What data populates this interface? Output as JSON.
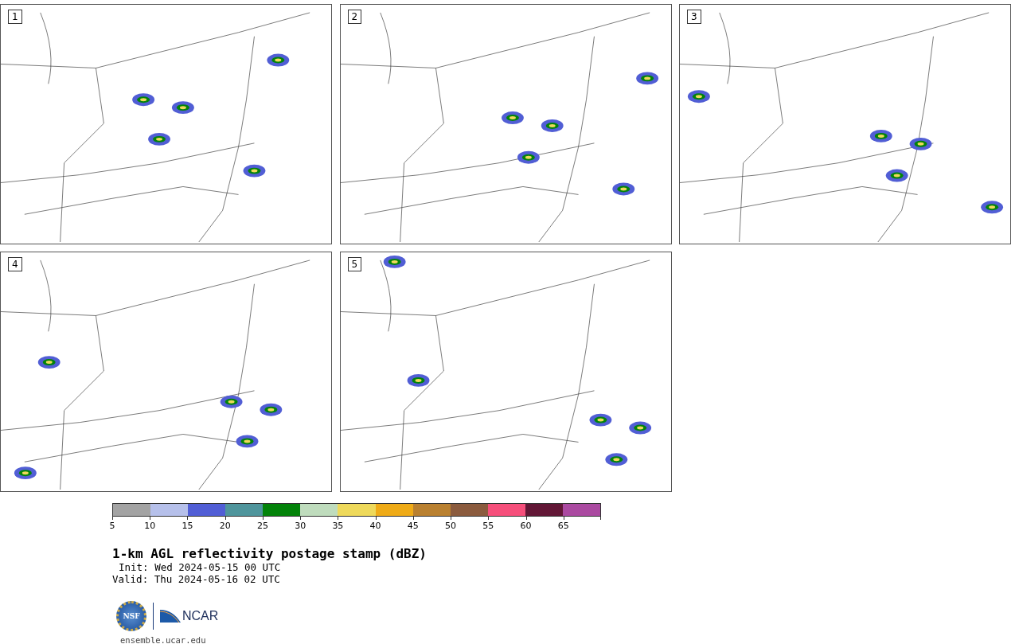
{
  "panels": [
    {
      "label": "1"
    },
    {
      "label": "2"
    },
    {
      "label": "3"
    },
    {
      "label": "4"
    },
    {
      "label": "5"
    }
  ],
  "colorbar": {
    "segments": [
      {
        "color": "#a3a3a3"
      },
      {
        "color": "#b6c0ea"
      },
      {
        "color": "#515ed5"
      },
      {
        "color": "#4f959c"
      },
      {
        "color": "#03830a"
      },
      {
        "color": "#bfdcbd"
      },
      {
        "color": "#eed95b"
      },
      {
        "color": "#efab17"
      },
      {
        "color": "#b98030"
      },
      {
        "color": "#8b5b3e"
      },
      {
        "color": "#f64f7b"
      },
      {
        "color": "#621736"
      },
      {
        "color": "#ab4aa1"
      }
    ],
    "ticks": [
      "5",
      "10",
      "15",
      "20",
      "25",
      "30",
      "35",
      "40",
      "45",
      "50",
      "55",
      "60",
      "65"
    ]
  },
  "title": "1-km AGL reflectivity postage stamp (dBZ)",
  "init": "Init: Wed 2024-05-15 00 UTC",
  "valid": "Valid: Thu 2024-05-16 02 UTC",
  "logos": {
    "seal": "NSF",
    "wordmark": "NCAR"
  },
  "footer": "ensemble.ucar.edu"
}
